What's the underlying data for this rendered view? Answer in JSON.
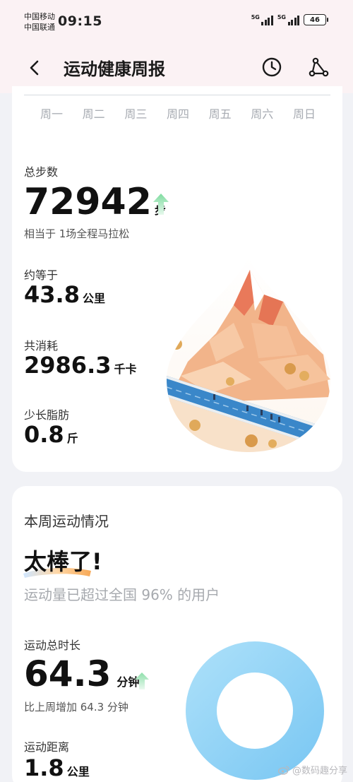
{
  "status": {
    "carrier1": "中国移动",
    "carrier2": "中国联通",
    "time": "09:15",
    "signal1": "5G",
    "signal2": "5G",
    "battery": "46"
  },
  "nav": {
    "title": "运动健康周报"
  },
  "week": {
    "days": [
      "周一",
      "周二",
      "周三",
      "周四",
      "周五",
      "周六",
      "周日"
    ]
  },
  "steps": {
    "label": "总步数",
    "value": "72942",
    "unit": "步",
    "note": "相当于 1场全程马拉松"
  },
  "distance": {
    "label": "约等于",
    "value": "43.8",
    "unit": "公里"
  },
  "calories": {
    "label": "共消耗",
    "value": "2986.3",
    "unit": "千卡"
  },
  "fat": {
    "label": "少长脂肪",
    "value": "0.8",
    "unit": "斤"
  },
  "summary": {
    "title": "本周运动情况",
    "praise": "太棒了!",
    "compare": "运动量已超过全国 96% 的用户"
  },
  "duration": {
    "label": "运动总时长",
    "value": "64.3",
    "unit": "分钟",
    "note": "比上周增加 64.3 分钟"
  },
  "exercise_distance": {
    "label": "运动距离",
    "value": "1.8",
    "unit": "公里"
  },
  "watermark": "@数码趣分享",
  "colors": {
    "header_bg": "#fbf2f4",
    "page_bg": "#f1f2f6",
    "arrow_green": "#9ee3b5",
    "donut_blue": "#8fd3f7"
  }
}
